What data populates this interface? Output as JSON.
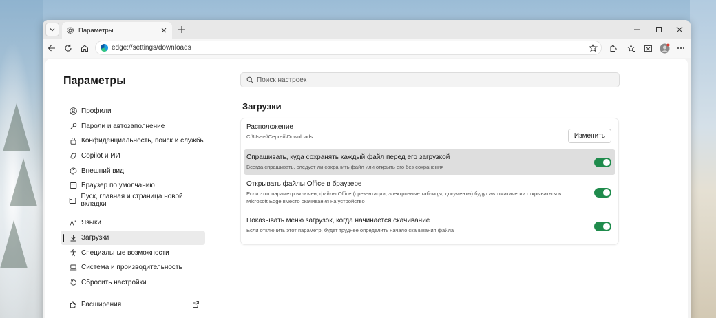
{
  "browser": {
    "tab_title": "Параметры",
    "address": "edge://settings/downloads"
  },
  "sidebar": {
    "title": "Параметры",
    "groups": [
      [
        {
          "label": "Профили",
          "icon": "profile-icon"
        },
        {
          "label": "Пароли и автозаполнение",
          "icon": "key-icon"
        },
        {
          "label": "Конфиденциальность, поиск и службы",
          "icon": "lock-icon"
        },
        {
          "label": "Copilot и ИИ",
          "icon": "copilot-icon"
        },
        {
          "label": "Внешний вид",
          "icon": "palette-icon"
        },
        {
          "label": "Браузер по умолчанию",
          "icon": "browser-icon"
        },
        {
          "label": "Пуск, главная и страница новой вкладки",
          "icon": "newtab-icon"
        }
      ],
      [
        {
          "label": "Языки",
          "icon": "languages-icon"
        },
        {
          "label": "Загрузки",
          "icon": "download-icon",
          "active": true
        },
        {
          "label": "Специальные возможности",
          "icon": "accessibility-icon"
        },
        {
          "label": "Система и производительность",
          "icon": "laptop-icon"
        },
        {
          "label": "Сбросить настройки",
          "icon": "reset-icon"
        }
      ],
      [
        {
          "label": "Расширения",
          "icon": "extensions-icon",
          "external": true
        }
      ]
    ]
  },
  "search": {
    "placeholder": "Поиск настроек"
  },
  "downloads": {
    "heading": "Загрузки",
    "location": {
      "label": "Расположение",
      "path": "C:\\Users\\Сергей\\Downloads",
      "button": "Изменить"
    },
    "settings": [
      {
        "label": "Спрашивать, куда сохранять каждый файл перед его загрузкой",
        "desc": "Всегда спрашивать, следует ли сохранить файл или открыть его без сохранения",
        "enabled": true
      },
      {
        "label": "Открывать файлы Office в браузере",
        "desc": "Если этот параметр включен, файлы Office (презентации, электронные таблицы, документы) будут автоматически открываться в Microsoft Edge вместо скачивания на устройство",
        "enabled": true
      },
      {
        "label": "Показывать меню загрузок, когда начинается скачивание",
        "desc": "Если отключить этот параметр, будет труднее определить начало скачивания файла",
        "enabled": true
      }
    ]
  },
  "colors": {
    "toggle_on": "#1f8b4c",
    "highlight_row": "#dedede"
  }
}
